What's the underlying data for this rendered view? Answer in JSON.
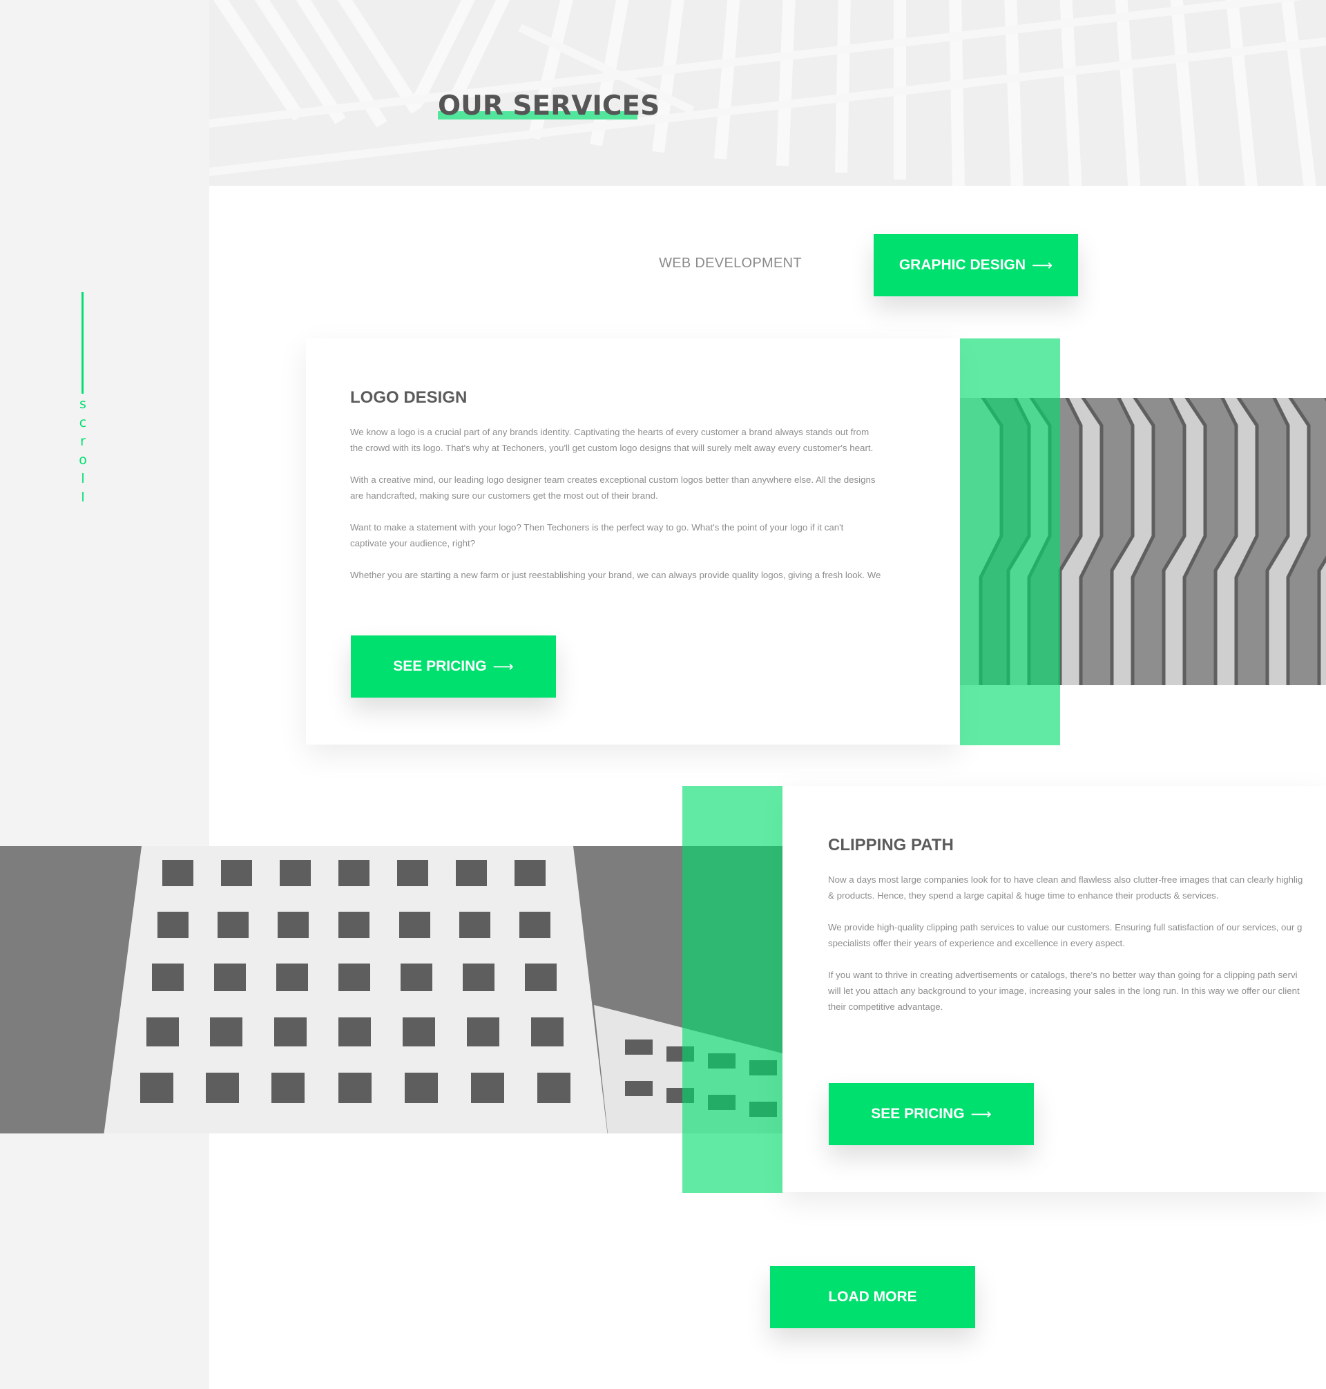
{
  "sidebar": {
    "scroll_label": [
      "s",
      "c",
      "r",
      "o",
      "l",
      "l"
    ]
  },
  "header": {
    "title": "OUR SERVICES"
  },
  "tabs": [
    {
      "label": "WEB DEVELOPMENT",
      "active": false
    },
    {
      "label": "GRAPHIC DESIGN",
      "active": true
    }
  ],
  "services": [
    {
      "title": "LOGO DESIGN",
      "paragraphs": [
        [
          "We know a logo is a crucial part of any brands identity. Captivating the hearts of every customer a brand always stands out from",
          "the crowd with its logo. That's why at Techoners, you'll get custom logo designs that will surely melt away every customer's heart."
        ],
        [
          "With a creative mind, our leading logo designer team creates exceptional custom logos better than anywhere else. All the designs",
          "are handcrafted, making sure our customers get the most out of their brand."
        ],
        [
          "Want to make a statement with your logo? Then Techoners is the perfect way to go. What's the point of your logo if it can't",
          "captivate your audience, right?"
        ],
        [
          "Whether you are starting a new farm or just reestablishing your brand, we can always provide quality logos, giving a fresh look. We"
        ]
      ],
      "button": "SEE PRICING"
    },
    {
      "title": "CLIPPING PATH",
      "paragraphs": [
        [
          "Now a days most large companies look for to have clean and flawless also clutter-free images that can clearly highlig",
          "& products. Hence, they spend a large capital & huge time to enhance their products & services."
        ],
        [
          "We provide high-quality clipping path services to value our customers. Ensuring full satisfaction of our services, our g",
          "specialists offer their years of experience and excellence in every aspect."
        ],
        [
          "If you want to thrive in creating advertisements or catalogs, there's no better way than going for a clipping path servi",
          "will let you attach any background to your image, increasing your sales in the long run. In this way we offer our client",
          "their competitive advantage."
        ]
      ],
      "button": "SEE PRICING"
    }
  ],
  "load_more": "LOAD MORE",
  "arrow_glyph": "⟶",
  "colors": {
    "accent": "#00e06f",
    "sidebar_bg": "#f3f3f3",
    "heading": "#5b5b5b",
    "body_text": "#8d8d8d"
  },
  "icons": [
    "right-arrow-icon"
  ]
}
